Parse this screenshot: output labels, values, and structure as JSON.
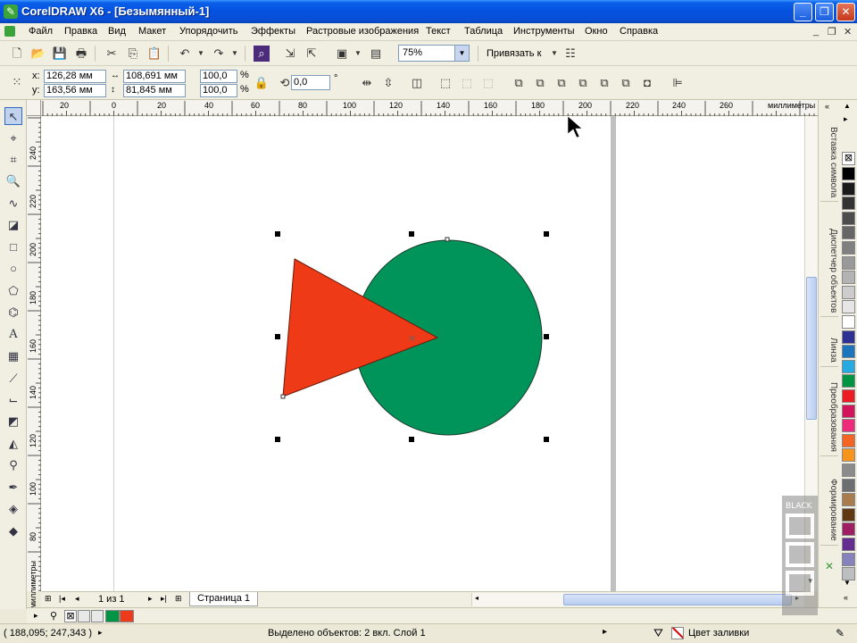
{
  "window": {
    "title": "CorelDRAW X6 - [Безымянный-1]"
  },
  "menu": [
    "Файл",
    "Правка",
    "Вид",
    "Макет",
    "Упорядочить",
    "Эффекты",
    "Растровые изображения",
    "Текст",
    "Таблица",
    "Инструменты",
    "Окно",
    "Справка"
  ],
  "toolbar": {
    "zoom": "75%",
    "snap_label": "Привязать к"
  },
  "propbar": {
    "x_label": "x:",
    "x_value": "126,28 мм",
    "y_label": "y:",
    "y_value": "163,56 мм",
    "w_value": "108,691 мм",
    "h_value": "81,845 мм",
    "scale_w": "100,0",
    "scale_h": "100,0",
    "pct": "%",
    "angle": "0,0",
    "deg": "°"
  },
  "ruler": {
    "unit": "миллиметры",
    "h_ticks": [
      "20",
      "0",
      "20",
      "40",
      "60",
      "80",
      "100",
      "120",
      "140",
      "160",
      "180",
      "200",
      "220",
      "240",
      "260"
    ],
    "v_ticks": [
      "240",
      "220",
      "200",
      "180",
      "160",
      "140",
      "120",
      "100",
      "80"
    ]
  },
  "dockers": [
    "Вставка символа",
    "Диспетчер объектов",
    "Линза",
    "Преобразования",
    "Формирование"
  ],
  "palette": [
    "#000000",
    "#1a1a1a",
    "#333333",
    "#4d4d4d",
    "#666666",
    "#808080",
    "#999999",
    "#b3b3b3",
    "#cccccc",
    "#e6e6e6",
    "#ffffff",
    "#2e3192",
    "#1c75bc",
    "#27aae1",
    "#009444",
    "#ed1c24",
    "#d4145a",
    "#ee2a7b",
    "#f26522",
    "#f7941d",
    "#8b8b8b",
    "#6d6e71",
    "#a97c50",
    "#603913",
    "#9e1f63",
    "#662d91",
    "#8781bd",
    "#bcbec0"
  ],
  "pagenav": {
    "counter": "1 из 1",
    "page_tab": "Страница 1"
  },
  "doc_palette": [
    "#009444",
    "#ed3a1a"
  ],
  "status": {
    "coords": "( 188,095; 247,343 )",
    "selection": "Выделено объектов: 2 вкл. Слой 1",
    "fill_label": "Цвет заливки"
  },
  "colors": {
    "circle": "#00935a",
    "triangle": "#ee3a17"
  }
}
